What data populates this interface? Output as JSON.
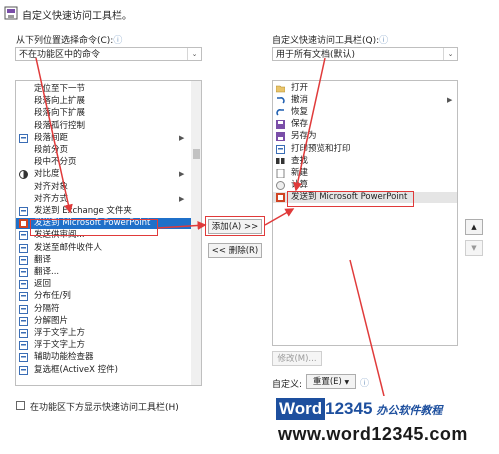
{
  "header": {
    "title": "自定义快速访问工具栏。"
  },
  "left": {
    "choose_label": "从下列位置选择命令(C):",
    "choose_value": "不在功能区中的命令",
    "items": [
      {
        "label": "定位至下一节",
        "icon": "none",
        "arrow": false
      },
      {
        "label": "段落向上扩展",
        "icon": "none",
        "arrow": false
      },
      {
        "label": "段落向下扩展",
        "icon": "none",
        "arrow": false
      },
      {
        "label": "段落孤行控制",
        "icon": "none",
        "arrow": false
      },
      {
        "label": "段落间距",
        "icon": "paragraph-spacing-icon",
        "arrow": true
      },
      {
        "label": "段前分页",
        "icon": "none",
        "arrow": false
      },
      {
        "label": "段中不分页",
        "icon": "none",
        "arrow": false
      },
      {
        "label": "对比度",
        "icon": "contrast-icon",
        "arrow": true
      },
      {
        "label": "对齐对象",
        "icon": "none",
        "arrow": false
      },
      {
        "label": "对齐方式",
        "icon": "none",
        "arrow": true
      },
      {
        "label": "发送到 Exchange 文件夹",
        "icon": "exchange-folder-icon",
        "arrow": false
      },
      {
        "label": "发送到 Microsoft PowerPoint",
        "icon": "powerpoint-icon",
        "arrow": false,
        "selected": true
      },
      {
        "label": "发送供审阅...",
        "icon": "send-review-icon",
        "arrow": false
      },
      {
        "label": "发送至邮件收件人",
        "icon": "mail-recipient-icon",
        "arrow": false
      },
      {
        "label": "翻译",
        "icon": "translate-icon",
        "arrow": false
      },
      {
        "label": "翻译...",
        "icon": "translate-icon",
        "arrow": false
      },
      {
        "label": "返回",
        "icon": "back-icon",
        "arrow": false
      },
      {
        "label": "分布任/列",
        "icon": "distribute-icon",
        "arrow": false
      },
      {
        "label": "分隔符",
        "icon": "separator-icon",
        "arrow": false
      },
      {
        "label": "分解图片",
        "icon": "ungroup-picture-icon",
        "arrow": false
      },
      {
        "label": "浮于文字上方",
        "icon": "float-above-icon",
        "arrow": false
      },
      {
        "label": "浮于文字上方",
        "icon": "float-above-icon",
        "arrow": false
      },
      {
        "label": "辅助功能检查器",
        "icon": "accessibility-icon",
        "arrow": false
      },
      {
        "label": "复选框(ActiveX 控件)",
        "icon": "checkbox-icon",
        "arrow": false
      }
    ],
    "show_below_label": "在功能区下方显示快速访问工具栏(H)"
  },
  "middle": {
    "add_label": "添加(A) >>",
    "remove_label": "<< 删除(R)"
  },
  "right": {
    "customize_label": "自定义快速访问工具栏(Q):",
    "customize_value": "用于所有文档(默认)",
    "items": [
      {
        "label": "打开",
        "icon": "open-folder-icon"
      },
      {
        "label": "撤消",
        "icon": "undo-icon",
        "arrow": true
      },
      {
        "label": "恢复",
        "icon": "redo-icon"
      },
      {
        "label": "保存",
        "icon": "save-icon"
      },
      {
        "label": "另存为",
        "icon": "save-as-icon"
      },
      {
        "label": "打印预览和打印",
        "icon": "print-preview-icon"
      },
      {
        "label": "查找",
        "icon": "find-icon"
      },
      {
        "label": "新建",
        "icon": "new-doc-icon"
      },
      {
        "label": "计算",
        "icon": "calculate-icon"
      },
      {
        "label": "发送到 Microsoft PowerPoint",
        "icon": "powerpoint-icon",
        "highlighted": true
      }
    ],
    "modify_label": "修改(M)...",
    "custom_label": "自定义:",
    "reset_label": "重置(E)",
    "reset_arrow": "▼"
  },
  "watermark": {
    "word": "Word",
    "number": "12345",
    "tagline": "办公软件教程",
    "url": "www.word12345.com"
  },
  "colors": {
    "selection": "#1f70c9",
    "highlight_border": "#e03a3a",
    "arrow": "#e03a3a"
  }
}
